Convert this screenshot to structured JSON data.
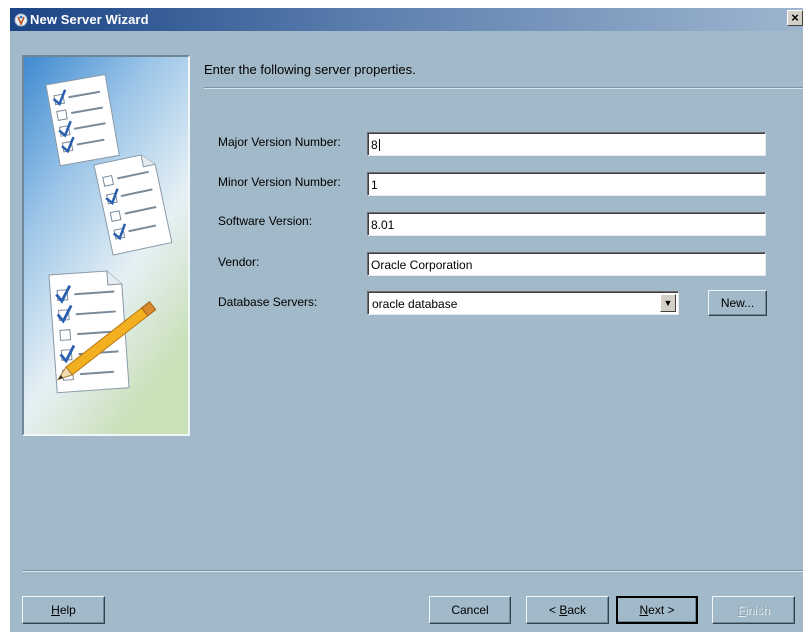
{
  "window": {
    "title": "New Server Wizard",
    "close_glyph": "×"
  },
  "heading": "Enter the following server properties.",
  "form": {
    "major_version": {
      "label": "Major Version Number:",
      "value": "8"
    },
    "minor_version": {
      "label": "Minor Version Number:",
      "value": "1"
    },
    "software_version": {
      "label": "Software Version:",
      "value": "8.01"
    },
    "vendor": {
      "label": "Vendor:",
      "value": "Oracle Corporation"
    },
    "database_servers": {
      "label": "Database Servers:",
      "selected": "oracle database",
      "new_button": "New..."
    }
  },
  "buttons": {
    "help": {
      "pre": "",
      "key": "H",
      "post": "elp"
    },
    "cancel": "Cancel",
    "back": {
      "pre": "< ",
      "key": "B",
      "post": "ack"
    },
    "next": {
      "pre": "",
      "key": "N",
      "post": "ext >"
    },
    "finish": {
      "pre": "",
      "key": "F",
      "post": "inish"
    }
  },
  "icons": {
    "title_icon": "wizard-icon",
    "side_image": "checklist-pencil-illustration",
    "dropdown_arrow": "chevron-down-icon"
  },
  "colors": {
    "background": "#a1b9c8",
    "titlebar": "#1b4486",
    "check": "#2a5fb0"
  }
}
